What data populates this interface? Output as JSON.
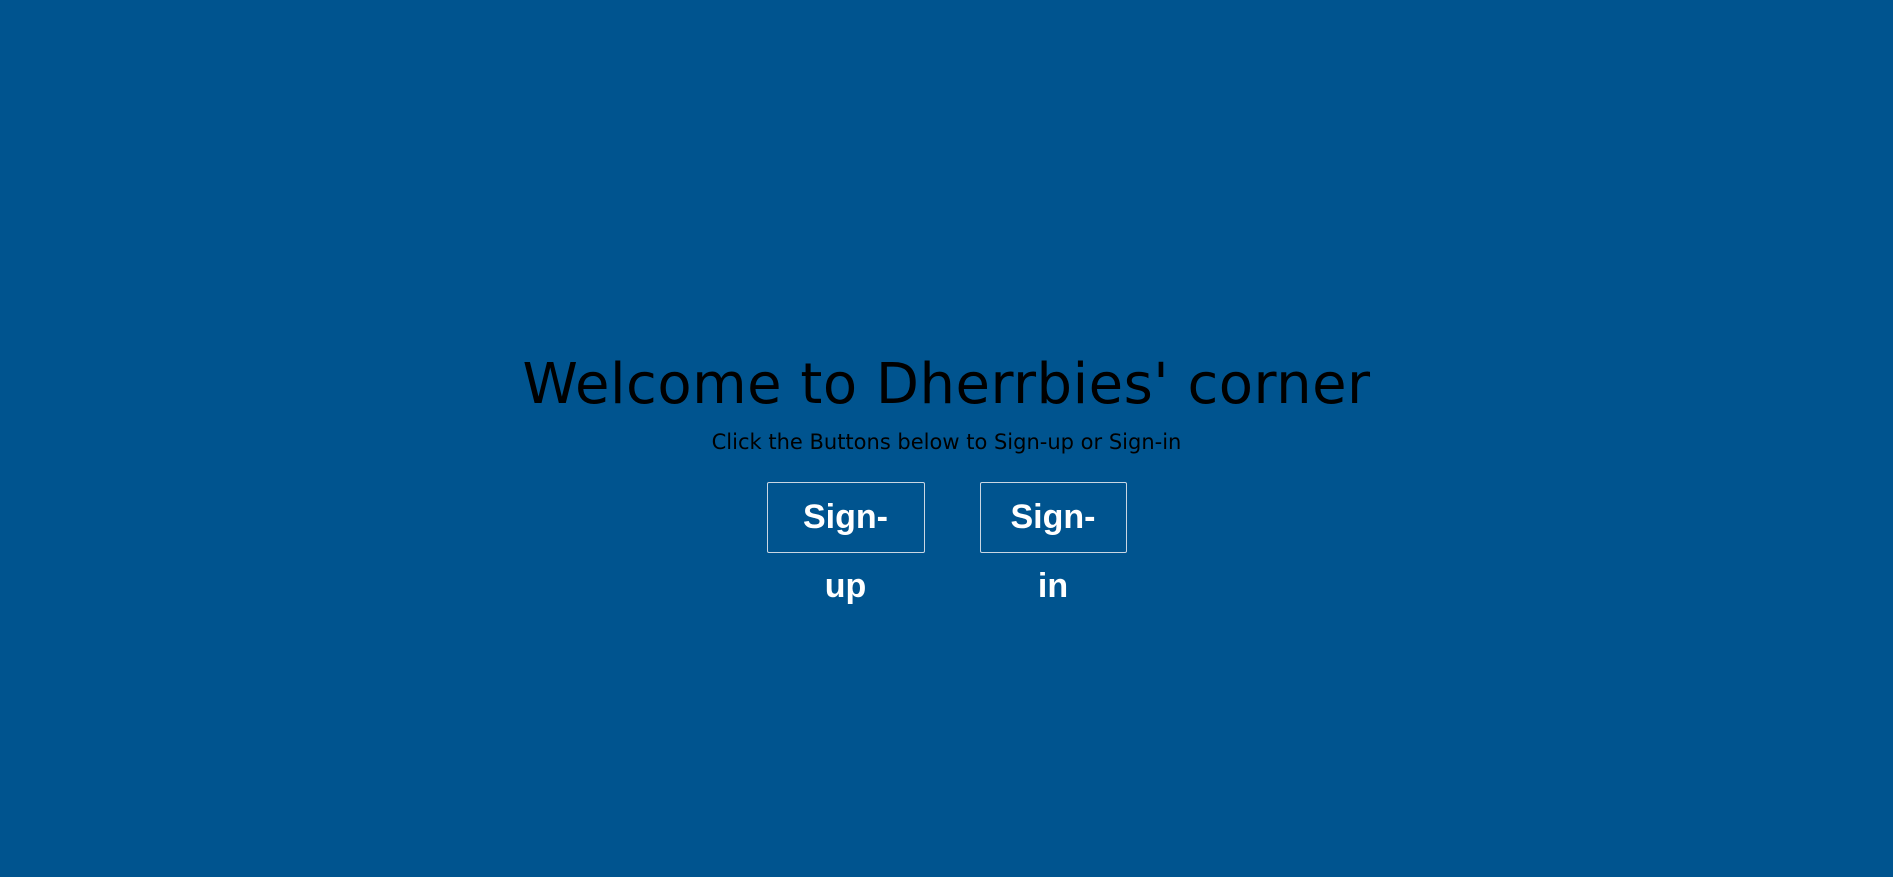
{
  "colors": {
    "background": "#00548f",
    "text": "#000000",
    "button_text": "#ffffff",
    "button_border": "#c9d6e3"
  },
  "welcome": {
    "title": "Welcome to Dherrbies' corner",
    "subtitle": "Click the Buttons below to Sign-up or Sign-in"
  },
  "actions": {
    "signup_label": "Sign-up",
    "signin_label": "Sign-in"
  }
}
